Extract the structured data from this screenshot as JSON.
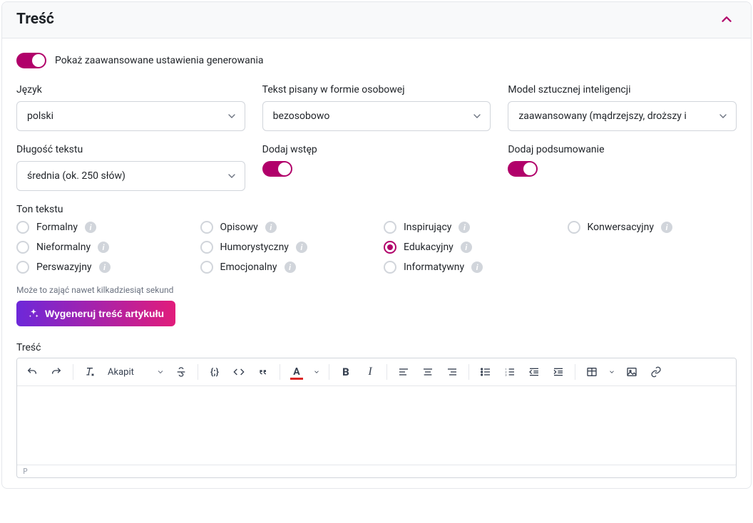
{
  "card": {
    "title": "Treść"
  },
  "advanced": {
    "label": "Pokaż zaawansowane ustawienia generowania",
    "enabled": true
  },
  "fields": {
    "language": {
      "label": "Język",
      "value": "polski"
    },
    "person": {
      "label": "Tekst pisany w formie osobowej",
      "value": "bezosobowo"
    },
    "model": {
      "label": "Model sztucznej inteligencji",
      "value": "zaawansowany (mądrzejszy, droższy i"
    },
    "length": {
      "label": "Długość tekstu",
      "value": "średnia (ok. 250 słów)"
    },
    "intro": {
      "label": "Dodaj wstęp",
      "enabled": true
    },
    "summary": {
      "label": "Dodaj podsumowanie",
      "enabled": true
    }
  },
  "tone": {
    "label": "Ton tekstu",
    "options": [
      {
        "label": "Formalny",
        "checked": false
      },
      {
        "label": "Opisowy",
        "checked": false
      },
      {
        "label": "Inspirujący",
        "checked": false
      },
      {
        "label": "Konwersacyjny",
        "checked": false
      },
      {
        "label": "Nieformalny",
        "checked": false
      },
      {
        "label": "Humorystyczny",
        "checked": false
      },
      {
        "label": "Edukacyjny",
        "checked": true
      },
      {
        "label": "",
        "checked": false,
        "empty": true
      },
      {
        "label": "Perswazyjny",
        "checked": false
      },
      {
        "label": "Emocjonalny",
        "checked": false
      },
      {
        "label": "Informatywny",
        "checked": false
      }
    ]
  },
  "note": "Może to zająć nawet kilkadziesiąt sekund",
  "generate_button": "Wygeneruj treść artykułu",
  "editor": {
    "label": "Treść",
    "format_select": "Akapit",
    "status": "P"
  }
}
